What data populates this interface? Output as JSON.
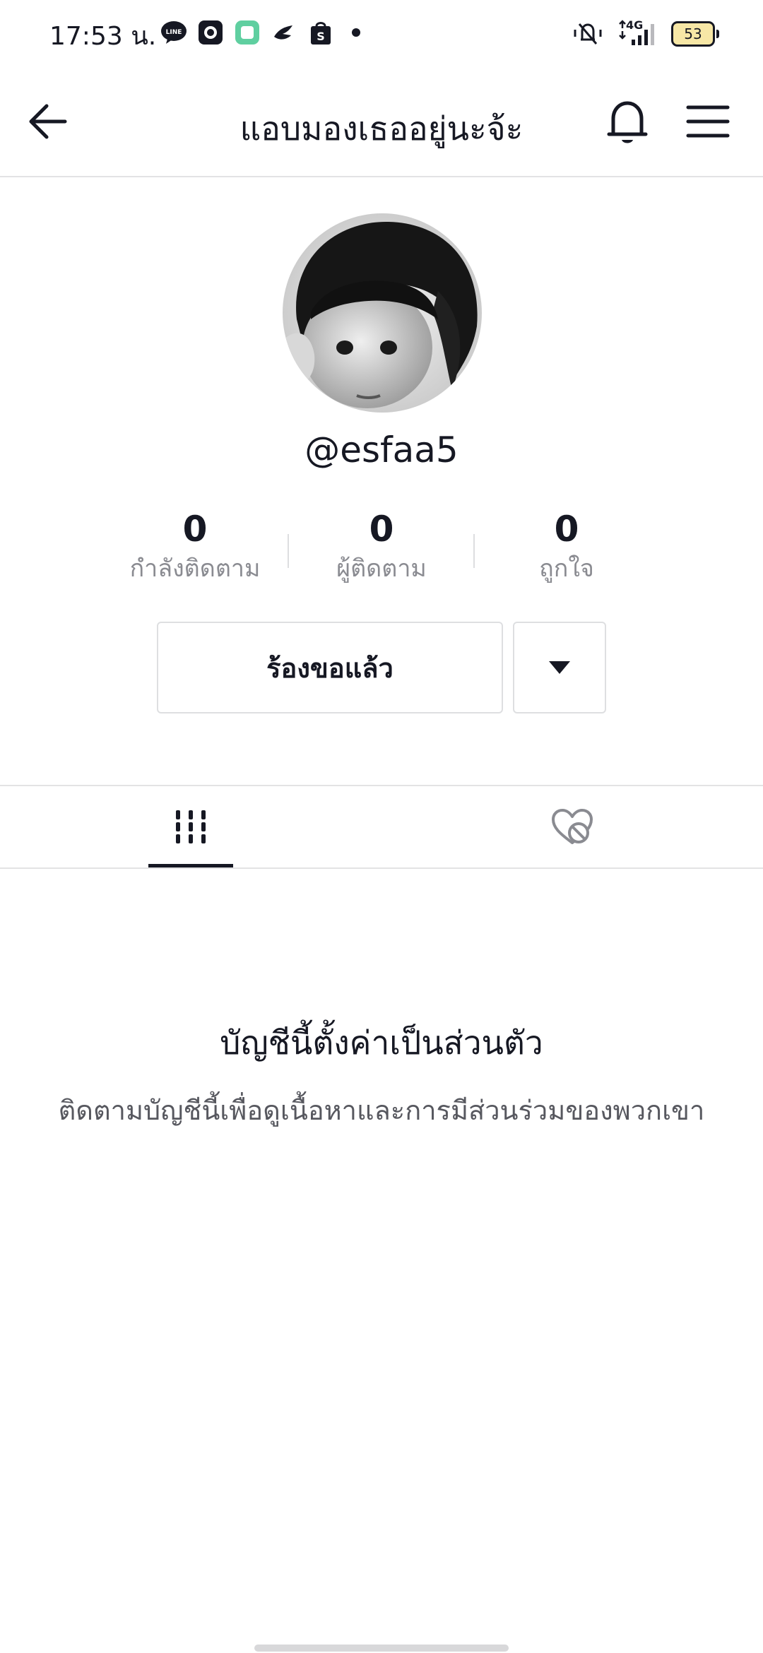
{
  "status_bar": {
    "time": "17:53 น.",
    "network": "4G",
    "battery": "53",
    "left_icons": [
      "line-icon",
      "camera-app-icon",
      "notes-app-icon",
      "bird-app-icon",
      "shopee-icon"
    ],
    "right_icons": [
      "vibrate-silent-icon",
      "signal-4g-icon",
      "battery-icon"
    ]
  },
  "header": {
    "title": "แอบมองเธออยู่นะจ้ะ",
    "icons": [
      "back-arrow-icon",
      "bell-icon",
      "menu-icon"
    ]
  },
  "profile": {
    "username": "@esfaa5",
    "stats": [
      {
        "value": "0",
        "label": "กำลังติดตาม"
      },
      {
        "value": "0",
        "label": "ผู้ติดตาม"
      },
      {
        "value": "0",
        "label": "ถูกใจ"
      }
    ],
    "requested_button": "ร้องขอแล้ว"
  },
  "tabs": {
    "items": [
      "videos-grid-icon",
      "liked-hidden-icon"
    ],
    "active_index": 0
  },
  "private_notice": {
    "title": "บัญชีนี้ตั้งค่าเป็นส่วนตัว",
    "description": "ติดตามบัญชีนี้เพื่อดูเนื้อหาและการมีส่วนร่วมของพวกเขา"
  },
  "colors": {
    "text": "#161823",
    "muted": "#8a8b91",
    "divider": "#e3e3e4",
    "battery_fill": "#f7e7a6"
  }
}
